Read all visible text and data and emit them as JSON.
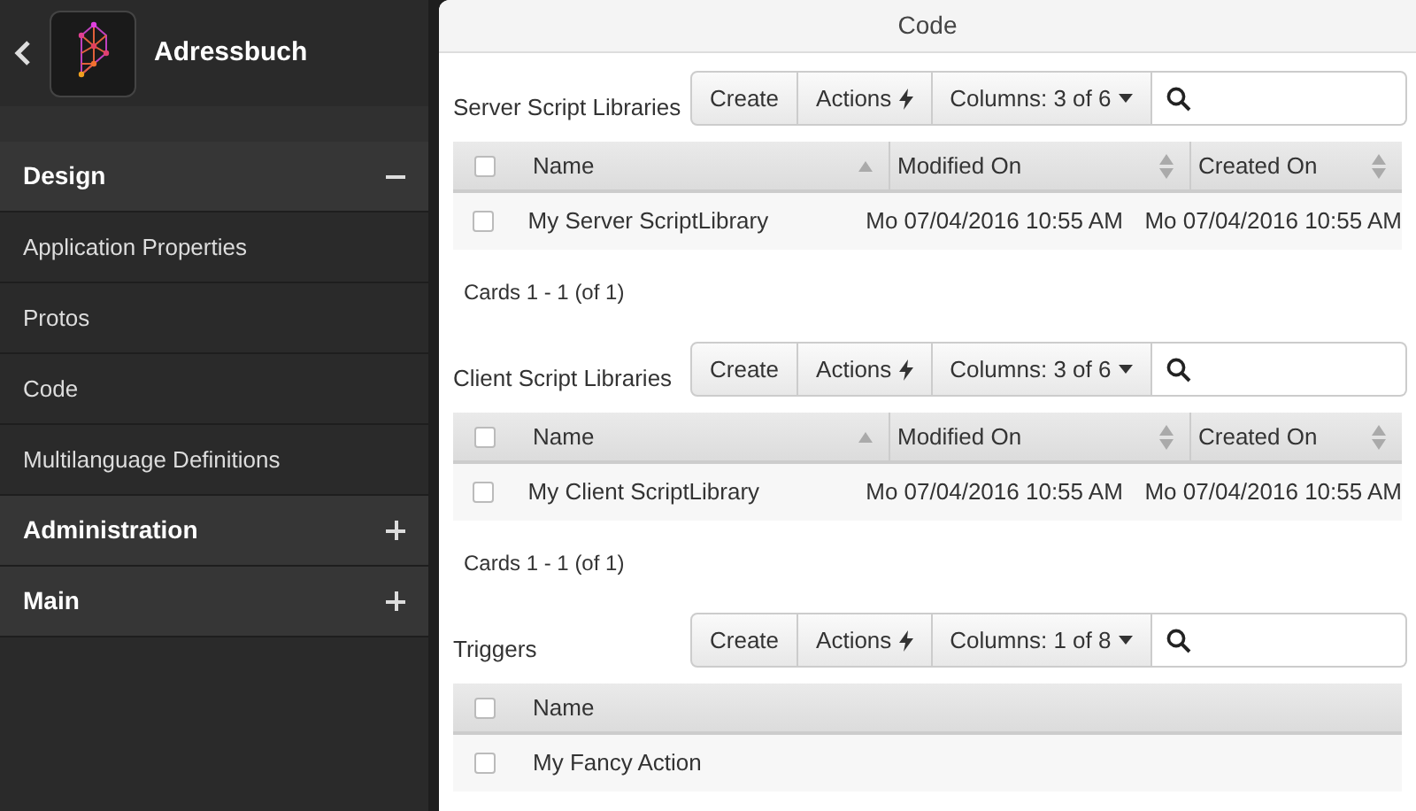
{
  "app": {
    "title": "Adressbuch"
  },
  "sidebar": {
    "groups": [
      {
        "label": "Design",
        "expanded": true,
        "items": [
          "Application Properties",
          "Protos",
          "Code",
          "Multilanguage Definitions"
        ]
      },
      {
        "label": "Administration",
        "expanded": false
      },
      {
        "label": "Main",
        "expanded": false
      }
    ]
  },
  "page": {
    "title": "Code"
  },
  "sections": [
    {
      "title": "Server Script Libraries",
      "buttons": [
        "Create",
        "Actions",
        "Columns: 3 of 6"
      ],
      "all_checked": false,
      "columns": [
        {
          "label": "Name",
          "sortable": true,
          "sorted": true
        },
        {
          "label": "Modified On",
          "sortable": true,
          "sorted": false
        },
        {
          "label": "Created On",
          "sortable": true,
          "sorted": false
        }
      ],
      "rows": [
        {
          "checked": false,
          "cells": [
            "My Server ScriptLibrary",
            "Mo 07/04/2016 10:55 AM",
            "Mo 07/04/2016 10:55 AM"
          ]
        }
      ],
      "footer": "Cards 1 - 1 (of 1)"
    },
    {
      "title": "Client Script Libraries",
      "buttons": [
        "Create",
        "Actions",
        "Columns: 3 of 6"
      ],
      "all_checked": false,
      "columns": [
        {
          "label": "Name",
          "sortable": true,
          "sorted": true
        },
        {
          "label": "Modified On",
          "sortable": true,
          "sorted": false
        },
        {
          "label": "Created On",
          "sortable": true,
          "sorted": false
        }
      ],
      "rows": [
        {
          "checked": false,
          "cells": [
            "My Client ScriptLibrary",
            "Mo 07/04/2016 10:55 AM",
            "Mo 07/04/2016 10:55 AM"
          ]
        }
      ],
      "footer": "Cards 1 - 1 (of 1)"
    },
    {
      "title": "Triggers",
      "buttons": [
        "Create",
        "Actions",
        "Columns: 1 of 8"
      ],
      "all_checked": false,
      "columns": [
        {
          "label": "Name",
          "sortable": false
        }
      ],
      "rows": [
        {
          "checked": false,
          "cells": [
            "My Fancy Action"
          ]
        }
      ]
    }
  ]
}
